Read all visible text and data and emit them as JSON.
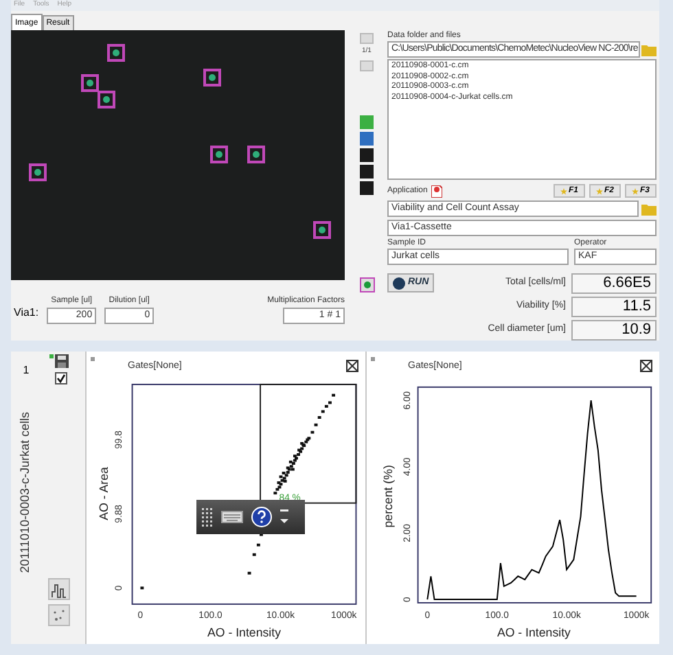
{
  "menu": [
    "File",
    "Tools",
    "Help"
  ],
  "tabs": [
    {
      "label": "Image",
      "selected": true
    },
    {
      "label": "Result",
      "selected": false
    }
  ],
  "image_nav": {
    "page": "1/1"
  },
  "color_swatches": [
    {
      "color": "#3cb043"
    },
    {
      "color": "#2f6fc0"
    },
    {
      "color": "#1a1a1a"
    },
    {
      "color": "#1a1a1a"
    },
    {
      "color": "#1a1a1a"
    }
  ],
  "dilution": {
    "label": "Via1:",
    "fields": [
      {
        "label": "Sample [ul]",
        "value": "200"
      },
      {
        "label": "Dilution [ul]",
        "value": "0"
      }
    ],
    "multiplication": {
      "label": "Multiplication Factors",
      "value": "1 # 1"
    }
  },
  "data_folder": {
    "label": "Data folder and files",
    "path": "C:\\Users\\Public\\Documents\\ChemoMetec\\NucleoView NC-200\\re",
    "files": [
      "20110908-0001-c.cm",
      "20110908-0002-c.cm",
      "20110908-0003-c.cm",
      "20110908-0004-c-Jurkat cells.cm"
    ]
  },
  "application": {
    "label": "Application",
    "function_keys": [
      "F1",
      "F2",
      "F3"
    ],
    "value": "Viability and Cell Count Assay",
    "cassette": "Via1-Cassette"
  },
  "sample_id": {
    "label": "Sample ID",
    "value": "Jurkat cells"
  },
  "operator": {
    "label": "Operator",
    "value": "KAF"
  },
  "run_button": "RUN",
  "results": [
    {
      "label": "Total [cells/ml]",
      "value": "6.66E5"
    },
    {
      "label": "Viability [%]",
      "value": "11.5"
    },
    {
      "label": "Cell diameter [um]",
      "value": "10.9"
    }
  ],
  "sample_list": {
    "index": "1",
    "checked": true,
    "name": "20111010-0003-c-Jurkat cells"
  },
  "plots": [
    {
      "kind": "scatter",
      "title": "Gates[None]",
      "x_axis_label": "AO - Intensity",
      "y_axis_label": "AO - Area",
      "x_tick_labels": [
        "0",
        "100.0",
        "10.00k",
        "1000k"
      ],
      "y_tick_labels": [
        "0",
        "9.88",
        "99.8"
      ],
      "gate_label": "84 %"
    },
    {
      "kind": "histogram",
      "title": "Gates[None]",
      "chart_data": {
        "type": "line",
        "xlabel": "AO - Intensity",
        "ylabel": "percent (%)",
        "categories": [
          "0",
          null,
          null,
          null,
          null,
          null,
          null,
          null,
          null,
          null,
          null,
          null,
          null,
          null,
          null,
          null,
          null,
          null,
          null,
          null,
          "100.0",
          null,
          null,
          null,
          null,
          null,
          null,
          null,
          null,
          null,
          null,
          null,
          null,
          null,
          null,
          null,
          null,
          null,
          null,
          null,
          "10.00k",
          null,
          null,
          null,
          null,
          null,
          null,
          null,
          null,
          null,
          null,
          null,
          null,
          null,
          null,
          null,
          null,
          null,
          null,
          null,
          "1000k"
        ],
        "series": [
          {
            "values": [
              0,
              0.7,
              0,
              0,
              0,
              0,
              0,
              0,
              0,
              0,
              0,
              0,
              0,
              0,
              0,
              0,
              0,
              0,
              0,
              0,
              0,
              1.1,
              0.4,
              0.45,
              0.5,
              0.6,
              0.7,
              0.65,
              0.6,
              0.75,
              0.9,
              0.85,
              0.8,
              1.05,
              1.3,
              1.45,
              1.6,
              2.0,
              2.4,
              1.8,
              0.9,
              1.05,
              1.2,
              1.85,
              2.5,
              3.8,
              5.0,
              6.0,
              5.2,
              4.5,
              3.3,
              2.4,
              1.5,
              0.8,
              0.2,
              0.1,
              0.1,
              0.1,
              0.1,
              0.1,
              0.1
            ]
          }
        ],
        "ylim": [
          -0.1,
          6.4
        ],
        "yticks": [
          {
            "value": 0,
            "label": "0"
          },
          {
            "value": 2,
            "label": "2.00"
          },
          {
            "value": 4,
            "label": "4.00"
          },
          {
            "value": 6,
            "label": "6.00"
          }
        ]
      }
    }
  ]
}
